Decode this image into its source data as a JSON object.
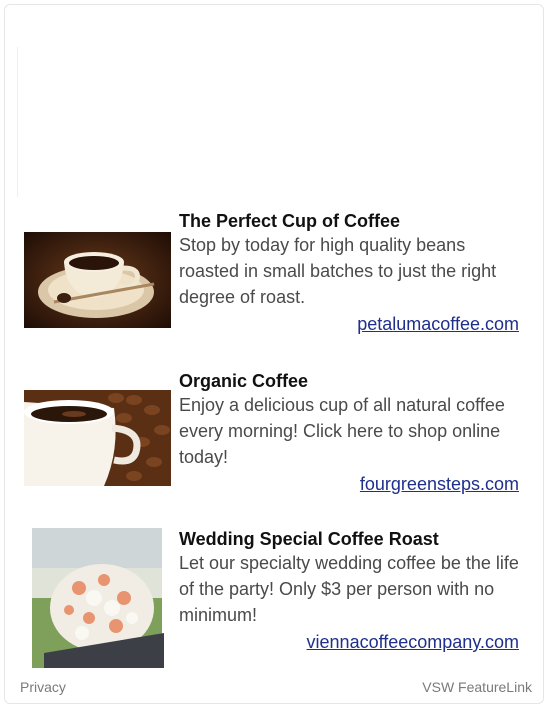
{
  "ads": [
    {
      "title": "The Perfect Cup of Coffee",
      "description": "Stop by today for high quality beans roasted in small batches to just the right degree of roast.",
      "link": "petalumacoffee.com",
      "image_icon": "coffee-cup-saucer-image"
    },
    {
      "title": "Organic Coffee",
      "description": "Enjoy a delicious cup of all natural coffee every morning! Click here to shop online today!",
      "link": "fourgreensteps.com",
      "image_icon": "coffee-mug-beans-image"
    },
    {
      "title": "Wedding Special Coffee Roast",
      "description": "Let our specialty wedding coffee be the life of the party! Only $3 per person with no minimum!",
      "link": "viennacoffeecompany.com",
      "image_icon": "wedding-bouquet-image"
    }
  ],
  "footer": {
    "left": "Privacy",
    "right": "VSW FeatureLink"
  },
  "colors": {
    "link": "#1f2f8a",
    "title": "#111111",
    "text": "#4a4a4a",
    "footer": "#7a7a7a"
  }
}
